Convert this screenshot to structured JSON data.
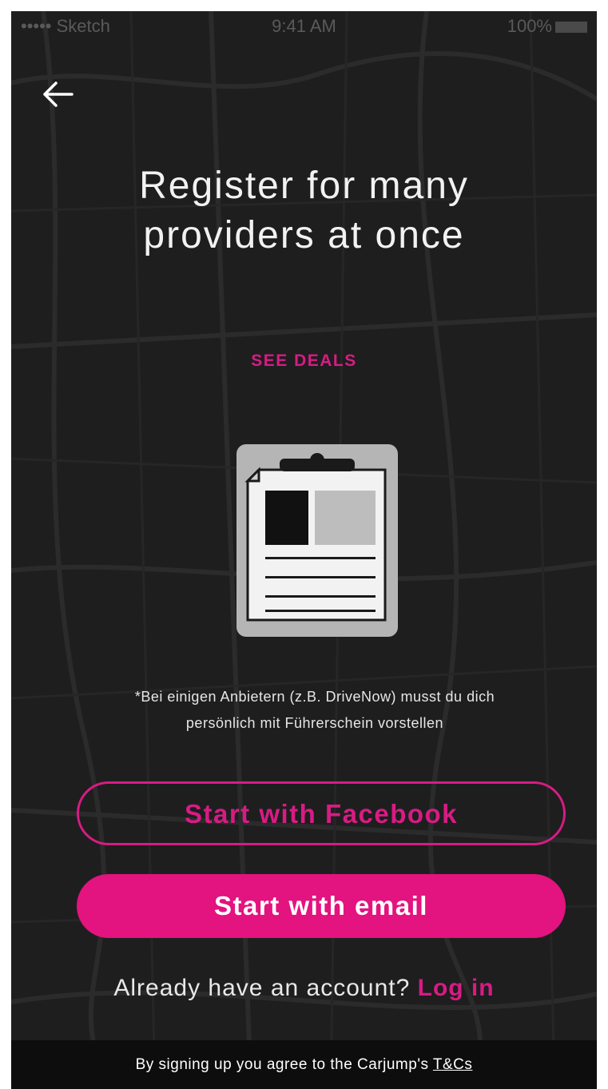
{
  "status_bar": {
    "carrier": "••••• Sketch",
    "time": "9:41 AM",
    "battery": "100%"
  },
  "back_icon": "arrow-left-icon",
  "title_lines": [
    "Register for many",
    "providers at once"
  ],
  "see_deals_label": "SEE DEALS",
  "illustration_icon": "clipboard-document-icon",
  "note_lines": [
    "*Bei einigen Anbietern (z.B. DriveNow) musst du dich",
    "persönlich mit Führerschein vorstellen"
  ],
  "facebook_button_label": "Start with Facebook",
  "email_button_label": "Start with email",
  "login": {
    "prompt": "Already have an account?",
    "link": "Log in"
  },
  "footer": {
    "text": "By signing up you agree to the Carjump's",
    "link": "T&Cs"
  },
  "colors": {
    "accent": "#e3137f",
    "background": "#1e1e1e",
    "footer_background": "#0d0d0d"
  }
}
